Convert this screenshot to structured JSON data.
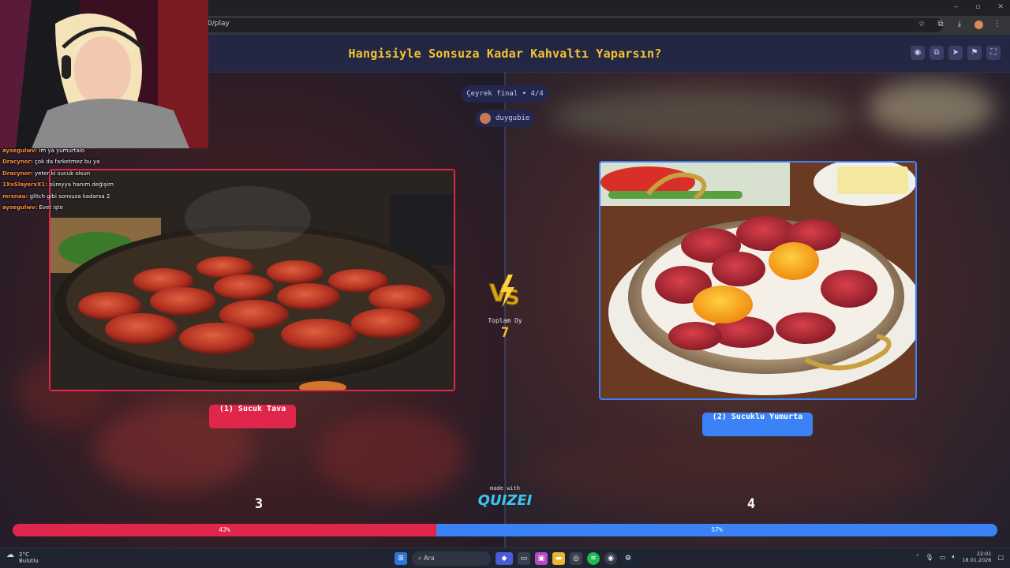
{
  "browser": {
    "url": "0/play",
    "window_controls": [
      "‒",
      "▫",
      "✕"
    ],
    "toolbar_icons": [
      "star-icon",
      "extensions-icon",
      "download-icon",
      "profile-avatar",
      "menu-icon"
    ]
  },
  "header": {
    "title": "Hangisiyle Sonsuza Kadar Kahvaltı Yaparsın?",
    "title_color": "#f4c430",
    "icons": [
      "eye-icon",
      "copy-icon",
      "share-icon",
      "flag-icon",
      "fullscreen-icon"
    ]
  },
  "round": {
    "label": "Çeyrek final • 4/4",
    "user": "duygubie"
  },
  "choices": [
    {
      "label": "(1) Sucuk Tava",
      "votes": "3",
      "percent": "43%",
      "share": 0.43,
      "color": "#e0264a"
    },
    {
      "label": "(2) Sucuklu Yumurta",
      "votes": "4",
      "percent": "57%",
      "share": 0.57,
      "color": "#3b82f6"
    }
  ],
  "total": {
    "label": "Toplam Oy",
    "value": "7"
  },
  "footer": {
    "made_with": "made with",
    "brand": "QUIZEI"
  },
  "chat": [
    {
      "user": "aysegulwv:",
      "message": "im ya yumurtalo"
    },
    {
      "user": "Dracynor:",
      "message": "çok da farketmez bu ya"
    },
    {
      "user": "Dracynor:",
      "message": "yeter ki sucuk olsun"
    },
    {
      "user": "1XxSlayerxX1:",
      "message": "süreyya hanım değişim"
    },
    {
      "user": "mrsnau:",
      "message": "glitch gibi sonsuza kadarsa 2"
    },
    {
      "user": "aysegulwv:",
      "message": "Evet işte"
    }
  ],
  "taskbar": {
    "weather_temp": "2°C",
    "weather_desc": "Bulutlu",
    "search_placeholder": "Ara",
    "time": "22:01",
    "date": "18.01.2026"
  }
}
